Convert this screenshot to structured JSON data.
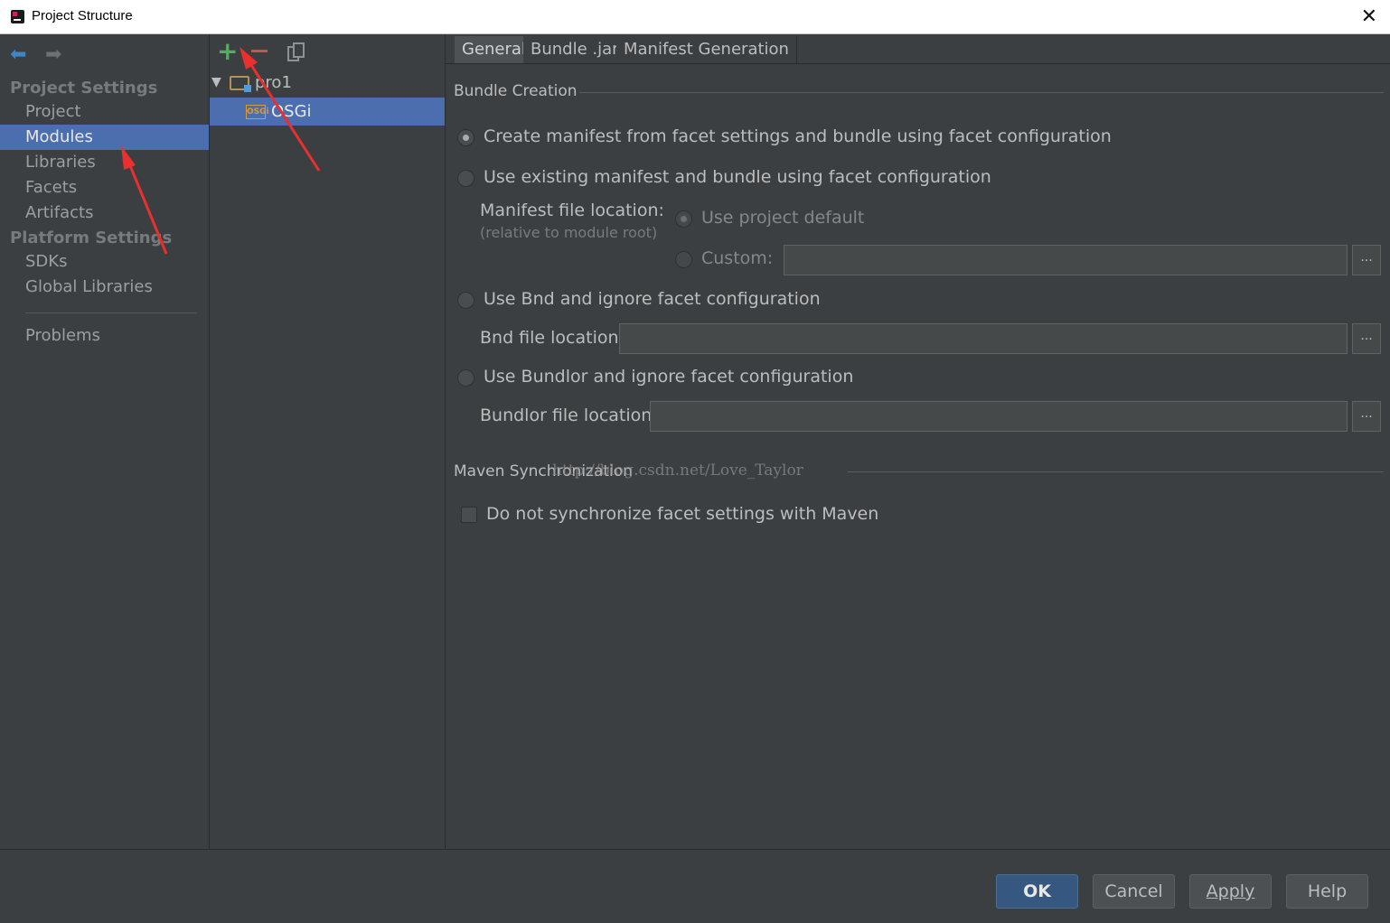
{
  "window": {
    "title": "Project Structure"
  },
  "sidebar": {
    "project_settings_header": "Project Settings",
    "project_items": [
      "Project",
      "Modules",
      "Libraries",
      "Facets",
      "Artifacts"
    ],
    "selected_item": "Modules",
    "platform_settings_header": "Platform Settings",
    "platform_items": [
      "SDKs",
      "Global Libraries"
    ],
    "problems": "Problems"
  },
  "tree": {
    "toolbar": {
      "add_icon": "plus-icon",
      "remove_icon": "minus-icon",
      "copy_icon": "copy-icon"
    },
    "root": "pro1",
    "child": "OSGi",
    "child_badge": "OSGi"
  },
  "tabs": [
    "General",
    "Bundle .jar",
    "Manifest Generation"
  ],
  "active_tab": "General",
  "bundle_creation": {
    "title": "Bundle Creation",
    "options": [
      "Create manifest from facet settings and bundle using facet configuration",
      "Use existing manifest and bundle using facet configuration",
      "Use Bnd and ignore facet configuration",
      "Use Bundlor and ignore facet configuration"
    ],
    "selected_option": 0,
    "manifest_location_label": "Manifest file location:",
    "manifest_location_hint": "(relative to module root)",
    "use_project_default": "Use project default",
    "custom_label": "Custom:",
    "custom_value": "",
    "bnd_label": "Bnd file location:",
    "bnd_value": "",
    "bundlor_label": "Bundlor file location:",
    "bundlor_value": "",
    "browse": "..."
  },
  "maven": {
    "title": "Maven Synchronization",
    "checkbox_label": "Do not synchronize facet settings with Maven",
    "checked": false
  },
  "watermark": "http://blog.csdn.net/Love_Taylor",
  "buttons": {
    "ok": "OK",
    "cancel": "Cancel",
    "apply": "Apply",
    "help": "Help"
  },
  "colors": {
    "background": "#3c3f41",
    "selection": "#4b6eaf",
    "annotation_arrow": "#e8302e",
    "add": "#59a869",
    "remove": "#c75450"
  }
}
